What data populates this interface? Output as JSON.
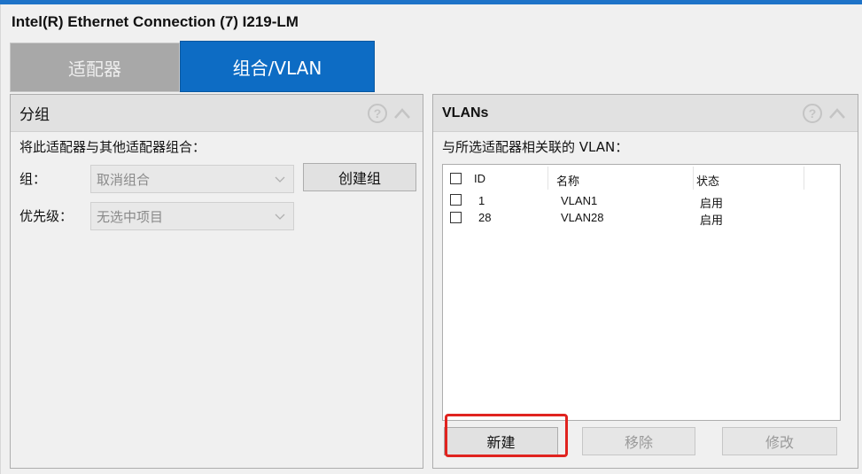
{
  "window": {
    "title": "Intel(R) Ethernet Connection (7) I219-LM"
  },
  "tabs": [
    {
      "label": "适配器",
      "active": false
    },
    {
      "label": "组合/VLAN",
      "active": true
    }
  ],
  "grouping": {
    "title": "分组",
    "description": "将此适配器与其他适配器组合：",
    "group_label": "组：",
    "group_value": "取消组合",
    "create_button": "创建组",
    "priority_label": "优先级：",
    "priority_value": "无选中项目"
  },
  "vlans": {
    "title": "VLANs",
    "description": "与所选适配器相关联的 VLAN：",
    "columns": [
      "ID",
      "名称",
      "状态"
    ],
    "rows": [
      {
        "id": "1",
        "name": "VLAN1",
        "status": "启用",
        "checked": false
      },
      {
        "id": "28",
        "name": "VLAN28",
        "status": "启用",
        "checked": false
      }
    ],
    "buttons": {
      "new": "新建",
      "remove": "移除",
      "modify": "修改"
    }
  },
  "icons": {
    "help": "?",
    "collapse": "chevron-up-icon"
  },
  "colors": {
    "accent": "#0d6cc4",
    "highlight": "#e0231f"
  }
}
